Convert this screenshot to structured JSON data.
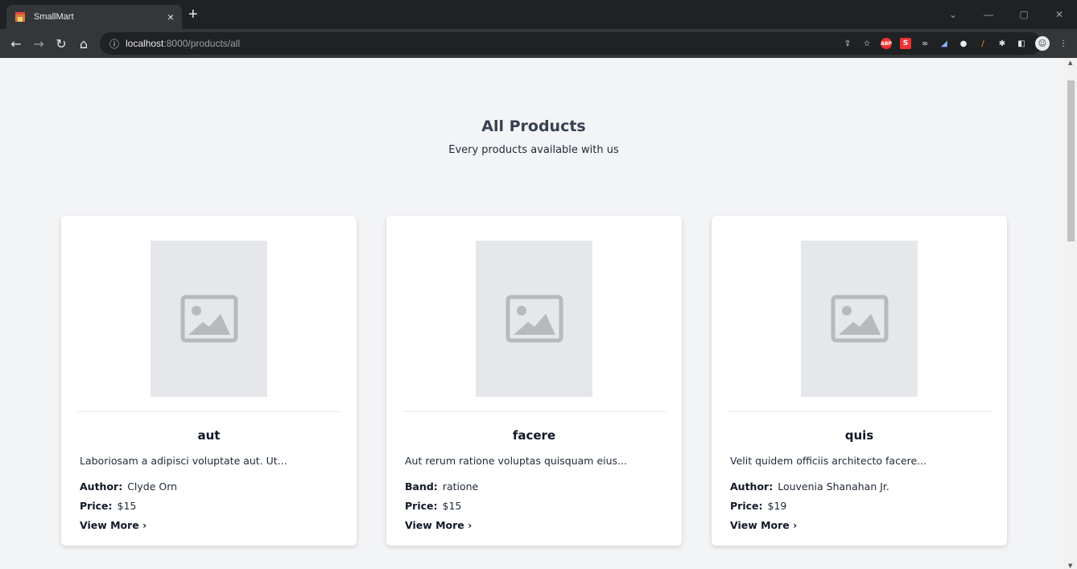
{
  "browser": {
    "tab_title": "SmallMart",
    "tab_close": "×",
    "new_tab": "+",
    "url_host": "localhost",
    "url_path": ":8000/products/all"
  },
  "page": {
    "title": "All Products",
    "subtitle": "Every products available with us"
  },
  "products": [
    {
      "name": "aut",
      "description": "Laboriosam a adipisci voluptate aut. Ut...",
      "meta_label": "Author:",
      "meta_value": "Clyde Orn",
      "price_label": "Price:",
      "price": "$15",
      "link": "View More ›"
    },
    {
      "name": "facere",
      "description": "Aut rerum ratione voluptas quisquam eius...",
      "meta_label": "Band:",
      "meta_value": "ratione",
      "price_label": "Price:",
      "price": "$15",
      "link": "View More ›"
    },
    {
      "name": "quis",
      "description": "Velit quidem officiis architecto facere...",
      "meta_label": "Author:",
      "meta_value": "Louvenia Shanahan Jr.",
      "price_label": "Price:",
      "price": "$19",
      "link": "View More ›"
    }
  ],
  "colors": {
    "page_bg": "#f3f4f6",
    "card_bg": "#ffffff",
    "placeholder_bg": "#e5e7eb",
    "placeholder_icon": "#b8b9bd",
    "heading": "#374151"
  },
  "icons": {
    "product_placeholder": "image-placeholder-icon"
  }
}
